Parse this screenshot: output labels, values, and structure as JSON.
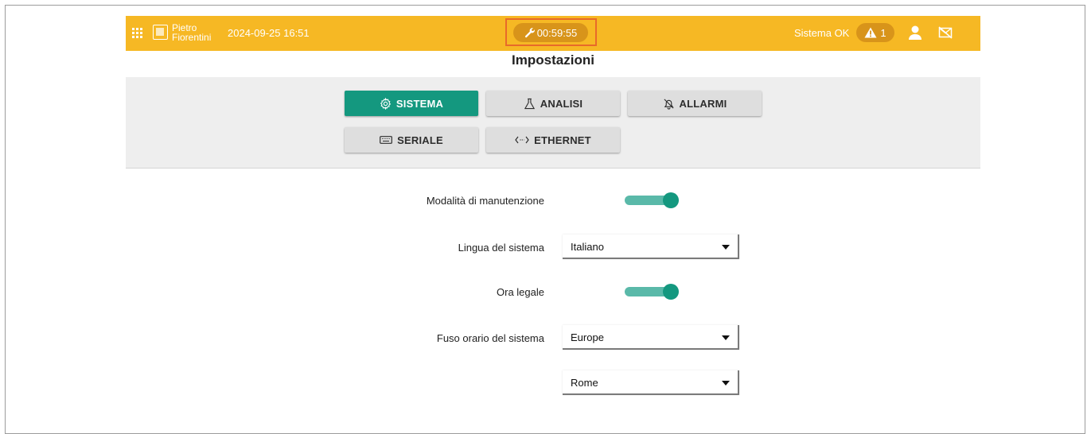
{
  "header": {
    "brand_line1": "Pietro",
    "brand_line2": "Fiorentini",
    "datetime": "2024-09-25 16:51",
    "maintenance_timer": "00:59:55",
    "status": "Sistema OK",
    "alarm_count": "1",
    "accent_color": "#f6b824"
  },
  "page": {
    "title": "Impostazioni"
  },
  "tabs": [
    {
      "label": "SISTEMA",
      "icon": "gear-icon",
      "active": true
    },
    {
      "label": "ANALISI",
      "icon": "flask-icon",
      "active": false
    },
    {
      "label": "ALLARMI",
      "icon": "bell-off-icon",
      "active": false
    },
    {
      "label": "SERIALE",
      "icon": "keyboard-icon",
      "active": false
    },
    {
      "label": "ETHERNET",
      "icon": "code-arrows-icon",
      "active": false
    }
  ],
  "form": {
    "maintenance_label": "Modalità di manutenzione",
    "maintenance_on": true,
    "language_label": "Lingua del sistema",
    "language_value": "Italiano",
    "dst_label": "Ora legale",
    "dst_on": true,
    "timezone_label": "Fuso orario del sistema",
    "timezone_region": "Europe",
    "timezone_city": "Rome"
  },
  "colors": {
    "primary": "#14987f",
    "toggle_track": "#5ab9a9"
  }
}
